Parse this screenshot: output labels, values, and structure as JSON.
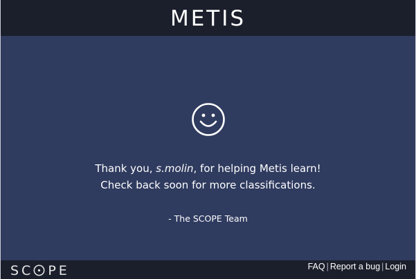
{
  "header": {
    "title": "METIS"
  },
  "main": {
    "icon": "smiley-face-icon",
    "thanks_prefix": "Thank you, ",
    "username": "s.molin",
    "thanks_suffix": ", for helping Metis learn!",
    "line2": "Check back soon for more classifications.",
    "signature": "- The SCOPE Team"
  },
  "footer": {
    "logo": "SCOPE",
    "links": {
      "faq": "FAQ",
      "report_bug": "Report a bug",
      "login": "Login"
    },
    "separator": "|"
  },
  "colors": {
    "topbar": "#1b1f2b",
    "main_background": "#2f3b5f",
    "text": "#ffffff"
  }
}
